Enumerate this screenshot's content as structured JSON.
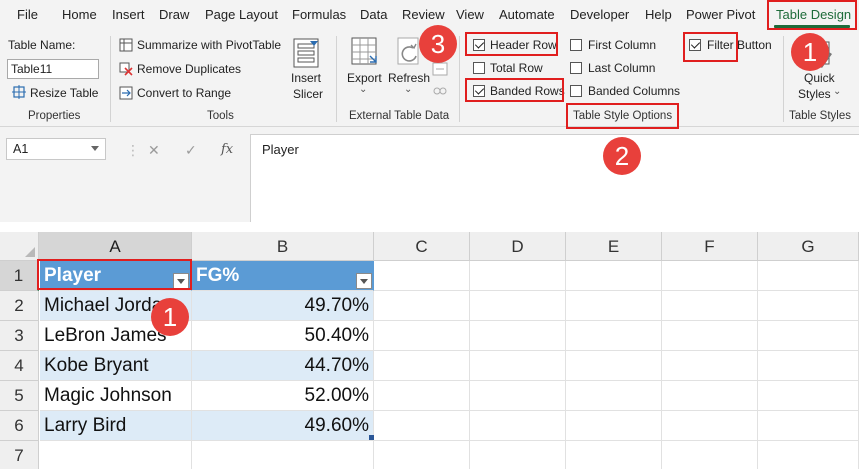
{
  "ribbon_tabs": [
    "File",
    "Home",
    "Insert",
    "Draw",
    "Page Layout",
    "Formulas",
    "Data",
    "Review",
    "View",
    "Automate",
    "Developer",
    "Help",
    "Power Pivot",
    "Table Design"
  ],
  "active_tab": "Table Design",
  "properties": {
    "table_name_label": "Table Name:",
    "table_name_value": "Table11",
    "resize_label": "Resize Table",
    "group_label": "Properties"
  },
  "tools": {
    "summarize": "Summarize with PivotTable",
    "remove_duplicates": "Remove Duplicates",
    "convert": "Convert to Range",
    "insert_slicer_line1": "Insert",
    "insert_slicer_line2": "Slicer",
    "group_label": "Tools"
  },
  "external": {
    "export": "Export",
    "refresh": "Refresh",
    "group_label": "External Table Data"
  },
  "style_options": {
    "header_row": {
      "label": "Header Row",
      "checked": true
    },
    "total_row": {
      "label": "Total Row",
      "checked": false
    },
    "banded_rows": {
      "label": "Banded Rows",
      "checked": true
    },
    "first_column": {
      "label": "First Column",
      "checked": false
    },
    "last_column": {
      "label": "Last Column",
      "checked": false
    },
    "banded_columns": {
      "label": "Banded Columns",
      "checked": false
    },
    "filter_button": {
      "label": "Filter Button",
      "checked": true
    },
    "group_label": "Table Style Options"
  },
  "quick_styles": {
    "line1": "Quick",
    "line2": "Styles",
    "group_label": "Table Styles"
  },
  "formula_bar": {
    "cell_ref": "A1",
    "cancel_symbol": "✕",
    "enter_symbol": "✓",
    "fx_symbol": "fx",
    "content": "Player"
  },
  "sheet": {
    "columns": [
      "A",
      "B",
      "C",
      "D",
      "E",
      "F",
      "G"
    ],
    "rows": [
      "1",
      "2",
      "3",
      "4",
      "5",
      "6",
      "7"
    ],
    "header": [
      "Player",
      "FG%"
    ],
    "data": [
      [
        "Michael Jordan",
        "49.70%"
      ],
      [
        "LeBron James",
        "50.40%"
      ],
      [
        "Kobe Bryant",
        "44.70%"
      ],
      [
        "Magic Johnson",
        "52.00%"
      ],
      [
        "Larry Bird",
        "49.60%"
      ]
    ]
  },
  "annotations": {
    "badge_quick_styles": "1",
    "badge_cell": "1",
    "badge_style_options": "2",
    "badge_header_row": "3"
  },
  "colors": {
    "accent_green": "#1e6b3a",
    "table_header_blue": "#5b9bd5",
    "band_light_blue": "#ddebf7",
    "highlight_red": "#e01e1e"
  }
}
